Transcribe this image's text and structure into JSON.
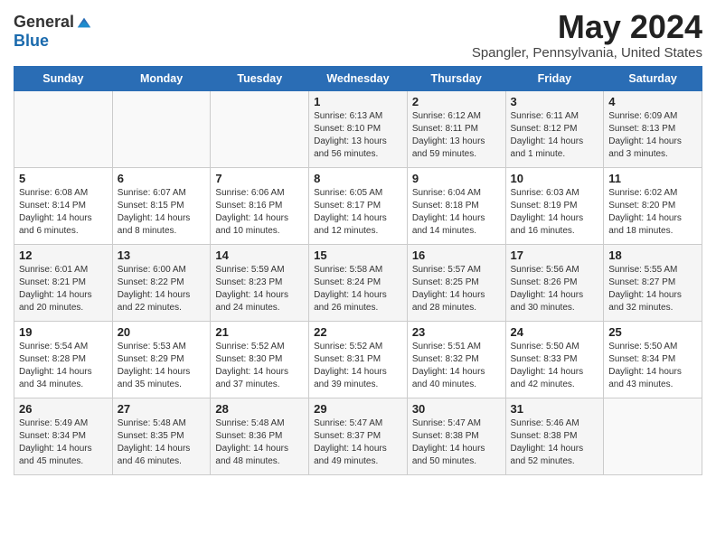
{
  "header": {
    "logo_general": "General",
    "logo_blue": "Blue",
    "title": "May 2024",
    "location": "Spangler, Pennsylvania, United States"
  },
  "days_of_week": [
    "Sunday",
    "Monday",
    "Tuesday",
    "Wednesday",
    "Thursday",
    "Friday",
    "Saturday"
  ],
  "weeks": [
    [
      {
        "day": "",
        "sunrise": "",
        "sunset": "",
        "daylight": ""
      },
      {
        "day": "",
        "sunrise": "",
        "sunset": "",
        "daylight": ""
      },
      {
        "day": "",
        "sunrise": "",
        "sunset": "",
        "daylight": ""
      },
      {
        "day": "1",
        "sunrise": "Sunrise: 6:13 AM",
        "sunset": "Sunset: 8:10 PM",
        "daylight": "Daylight: 13 hours and 56 minutes."
      },
      {
        "day": "2",
        "sunrise": "Sunrise: 6:12 AM",
        "sunset": "Sunset: 8:11 PM",
        "daylight": "Daylight: 13 hours and 59 minutes."
      },
      {
        "day": "3",
        "sunrise": "Sunrise: 6:11 AM",
        "sunset": "Sunset: 8:12 PM",
        "daylight": "Daylight: 14 hours and 1 minute."
      },
      {
        "day": "4",
        "sunrise": "Sunrise: 6:09 AM",
        "sunset": "Sunset: 8:13 PM",
        "daylight": "Daylight: 14 hours and 3 minutes."
      }
    ],
    [
      {
        "day": "5",
        "sunrise": "Sunrise: 6:08 AM",
        "sunset": "Sunset: 8:14 PM",
        "daylight": "Daylight: 14 hours and 6 minutes."
      },
      {
        "day": "6",
        "sunrise": "Sunrise: 6:07 AM",
        "sunset": "Sunset: 8:15 PM",
        "daylight": "Daylight: 14 hours and 8 minutes."
      },
      {
        "day": "7",
        "sunrise": "Sunrise: 6:06 AM",
        "sunset": "Sunset: 8:16 PM",
        "daylight": "Daylight: 14 hours and 10 minutes."
      },
      {
        "day": "8",
        "sunrise": "Sunrise: 6:05 AM",
        "sunset": "Sunset: 8:17 PM",
        "daylight": "Daylight: 14 hours and 12 minutes."
      },
      {
        "day": "9",
        "sunrise": "Sunrise: 6:04 AM",
        "sunset": "Sunset: 8:18 PM",
        "daylight": "Daylight: 14 hours and 14 minutes."
      },
      {
        "day": "10",
        "sunrise": "Sunrise: 6:03 AM",
        "sunset": "Sunset: 8:19 PM",
        "daylight": "Daylight: 14 hours and 16 minutes."
      },
      {
        "day": "11",
        "sunrise": "Sunrise: 6:02 AM",
        "sunset": "Sunset: 8:20 PM",
        "daylight": "Daylight: 14 hours and 18 minutes."
      }
    ],
    [
      {
        "day": "12",
        "sunrise": "Sunrise: 6:01 AM",
        "sunset": "Sunset: 8:21 PM",
        "daylight": "Daylight: 14 hours and 20 minutes."
      },
      {
        "day": "13",
        "sunrise": "Sunrise: 6:00 AM",
        "sunset": "Sunset: 8:22 PM",
        "daylight": "Daylight: 14 hours and 22 minutes."
      },
      {
        "day": "14",
        "sunrise": "Sunrise: 5:59 AM",
        "sunset": "Sunset: 8:23 PM",
        "daylight": "Daylight: 14 hours and 24 minutes."
      },
      {
        "day": "15",
        "sunrise": "Sunrise: 5:58 AM",
        "sunset": "Sunset: 8:24 PM",
        "daylight": "Daylight: 14 hours and 26 minutes."
      },
      {
        "day": "16",
        "sunrise": "Sunrise: 5:57 AM",
        "sunset": "Sunset: 8:25 PM",
        "daylight": "Daylight: 14 hours and 28 minutes."
      },
      {
        "day": "17",
        "sunrise": "Sunrise: 5:56 AM",
        "sunset": "Sunset: 8:26 PM",
        "daylight": "Daylight: 14 hours and 30 minutes."
      },
      {
        "day": "18",
        "sunrise": "Sunrise: 5:55 AM",
        "sunset": "Sunset: 8:27 PM",
        "daylight": "Daylight: 14 hours and 32 minutes."
      }
    ],
    [
      {
        "day": "19",
        "sunrise": "Sunrise: 5:54 AM",
        "sunset": "Sunset: 8:28 PM",
        "daylight": "Daylight: 14 hours and 34 minutes."
      },
      {
        "day": "20",
        "sunrise": "Sunrise: 5:53 AM",
        "sunset": "Sunset: 8:29 PM",
        "daylight": "Daylight: 14 hours and 35 minutes."
      },
      {
        "day": "21",
        "sunrise": "Sunrise: 5:52 AM",
        "sunset": "Sunset: 8:30 PM",
        "daylight": "Daylight: 14 hours and 37 minutes."
      },
      {
        "day": "22",
        "sunrise": "Sunrise: 5:52 AM",
        "sunset": "Sunset: 8:31 PM",
        "daylight": "Daylight: 14 hours and 39 minutes."
      },
      {
        "day": "23",
        "sunrise": "Sunrise: 5:51 AM",
        "sunset": "Sunset: 8:32 PM",
        "daylight": "Daylight: 14 hours and 40 minutes."
      },
      {
        "day": "24",
        "sunrise": "Sunrise: 5:50 AM",
        "sunset": "Sunset: 8:33 PM",
        "daylight": "Daylight: 14 hours and 42 minutes."
      },
      {
        "day": "25",
        "sunrise": "Sunrise: 5:50 AM",
        "sunset": "Sunset: 8:34 PM",
        "daylight": "Daylight: 14 hours and 43 minutes."
      }
    ],
    [
      {
        "day": "26",
        "sunrise": "Sunrise: 5:49 AM",
        "sunset": "Sunset: 8:34 PM",
        "daylight": "Daylight: 14 hours and 45 minutes."
      },
      {
        "day": "27",
        "sunrise": "Sunrise: 5:48 AM",
        "sunset": "Sunset: 8:35 PM",
        "daylight": "Daylight: 14 hours and 46 minutes."
      },
      {
        "day": "28",
        "sunrise": "Sunrise: 5:48 AM",
        "sunset": "Sunset: 8:36 PM",
        "daylight": "Daylight: 14 hours and 48 minutes."
      },
      {
        "day": "29",
        "sunrise": "Sunrise: 5:47 AM",
        "sunset": "Sunset: 8:37 PM",
        "daylight": "Daylight: 14 hours and 49 minutes."
      },
      {
        "day": "30",
        "sunrise": "Sunrise: 5:47 AM",
        "sunset": "Sunset: 8:38 PM",
        "daylight": "Daylight: 14 hours and 50 minutes."
      },
      {
        "day": "31",
        "sunrise": "Sunrise: 5:46 AM",
        "sunset": "Sunset: 8:38 PM",
        "daylight": "Daylight: 14 hours and 52 minutes."
      },
      {
        "day": "",
        "sunrise": "",
        "sunset": "",
        "daylight": ""
      }
    ]
  ]
}
